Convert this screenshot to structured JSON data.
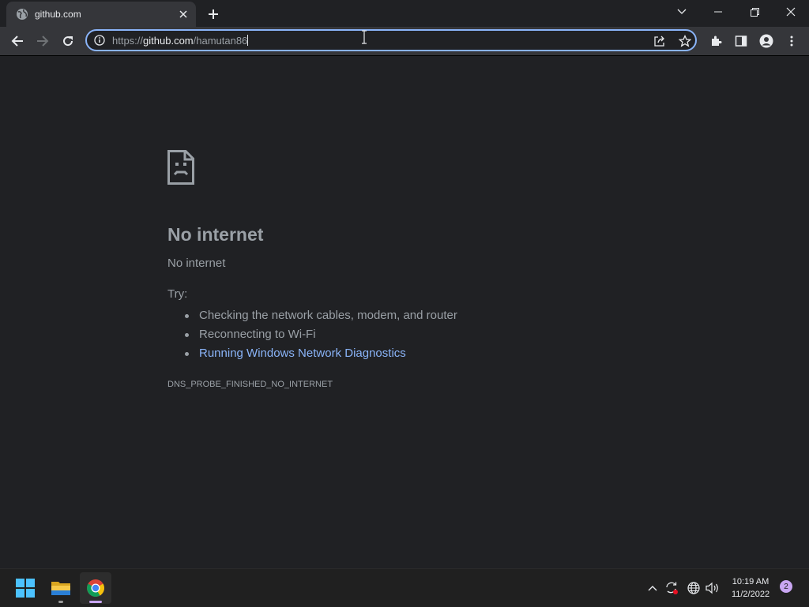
{
  "tab": {
    "title": "github.com",
    "close_symbol": "✕",
    "favicon": "globe-icon"
  },
  "omnibox": {
    "url_scheme": "https://",
    "url_host": "github.com",
    "url_path": "/hamutan86"
  },
  "page": {
    "title": "No internet",
    "subtitle": "No internet",
    "try_label": "Try:",
    "suggestions": [
      "Checking the network cables, modem, and router",
      "Reconnecting to Wi-Fi",
      "Running Windows Network Diagnostics"
    ],
    "error_code": "DNS_PROBE_FINISHED_NO_INTERNET"
  },
  "taskbar": {
    "time": "10:19 AM",
    "date": "11/2/2022",
    "notification_count": "2"
  },
  "colors": {
    "background": "#202124",
    "link": "#8ab4f8",
    "text": "#9aa0a6",
    "focus_ring": "#8ab4f8"
  }
}
